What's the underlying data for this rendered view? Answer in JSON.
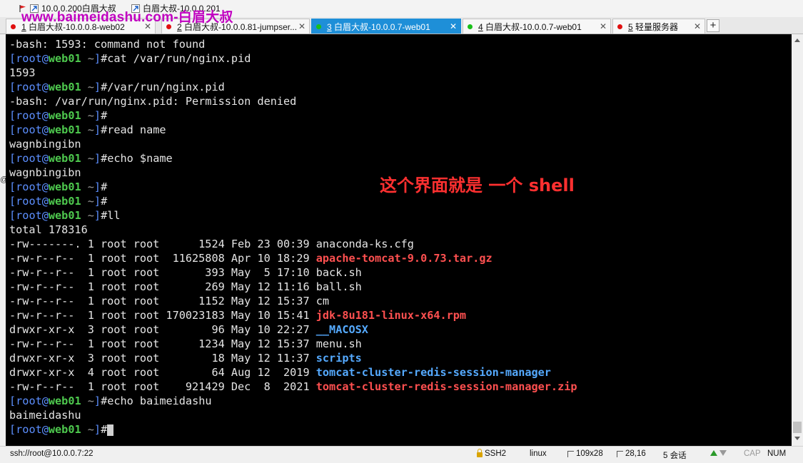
{
  "bookmarks": [
    {
      "label": "10.0.0.200白眉大叔",
      "icon": "red-flag-icon"
    },
    {
      "label": "白眉大叔-10.0.0.201",
      "icon": "shortcut-arrow-icon"
    }
  ],
  "watermark": "www.baimeidashu.com-白眉大叔",
  "tabs": [
    {
      "num": "1",
      "label": " 白眉大叔-10.0.0.8-web02",
      "dot_color": "#e01010",
      "active": false
    },
    {
      "num": "2",
      "label": " 白眉大叔-10.0.0.81-jumpser...",
      "dot_color": "#e01010",
      "active": false
    },
    {
      "num": "3",
      "label": " 白眉大叔-10.0.0.7-web01",
      "dot_color": "#19c019",
      "active": true
    },
    {
      "num": "4",
      "label": " 白眉大叔-10.0.0.7-web01",
      "dot_color": "#19c019",
      "active": false
    },
    {
      "num": "5",
      "label": " 轻量服务器",
      "dot_color": "#e01010",
      "active": false
    }
  ],
  "add_tab_label": "+",
  "annotation": "这个界面就是 一个 shell",
  "left_edge_char": "@",
  "terminal_lines": [
    [
      {
        "t": "-bash: 1593: command not found"
      }
    ],
    [
      {
        "t": "[",
        "c": "b"
      },
      {
        "t": "root",
        "c": "b"
      },
      {
        "t": "@",
        "c": "b"
      },
      {
        "t": "web01",
        "c": "g"
      },
      {
        "t": " ~",
        "c": "gr"
      },
      {
        "t": "]",
        "c": "b"
      },
      {
        "t": "#cat /var/run/nginx.pid"
      }
    ],
    [
      {
        "t": "1593"
      }
    ],
    [
      {
        "t": "[",
        "c": "b"
      },
      {
        "t": "root",
        "c": "b"
      },
      {
        "t": "@",
        "c": "b"
      },
      {
        "t": "web01",
        "c": "g"
      },
      {
        "t": " ~",
        "c": "gr"
      },
      {
        "t": "]",
        "c": "b"
      },
      {
        "t": "#/var/run/nginx.pid"
      }
    ],
    [
      {
        "t": "-bash: /var/run/nginx.pid: Permission denied"
      }
    ],
    [
      {
        "t": "[",
        "c": "b"
      },
      {
        "t": "root",
        "c": "b"
      },
      {
        "t": "@",
        "c": "b"
      },
      {
        "t": "web01",
        "c": "g"
      },
      {
        "t": " ~",
        "c": "gr"
      },
      {
        "t": "]",
        "c": "b"
      },
      {
        "t": "#"
      }
    ],
    [
      {
        "t": "[",
        "c": "b"
      },
      {
        "t": "root",
        "c": "b"
      },
      {
        "t": "@",
        "c": "b"
      },
      {
        "t": "web01",
        "c": "g"
      },
      {
        "t": " ~",
        "c": "gr"
      },
      {
        "t": "]",
        "c": "b"
      },
      {
        "t": "#read name"
      }
    ],
    [
      {
        "t": "wagnbingibn"
      }
    ],
    [
      {
        "t": "[",
        "c": "b"
      },
      {
        "t": "root",
        "c": "b"
      },
      {
        "t": "@",
        "c": "b"
      },
      {
        "t": "web01",
        "c": "g"
      },
      {
        "t": " ~",
        "c": "gr"
      },
      {
        "t": "]",
        "c": "b"
      },
      {
        "t": "#echo $name"
      }
    ],
    [
      {
        "t": "wagnbingibn"
      }
    ],
    [
      {
        "t": "[",
        "c": "b"
      },
      {
        "t": "root",
        "c": "b"
      },
      {
        "t": "@",
        "c": "b"
      },
      {
        "t": "web01",
        "c": "g"
      },
      {
        "t": " ~",
        "c": "gr"
      },
      {
        "t": "]",
        "c": "b"
      },
      {
        "t": "#"
      }
    ],
    [
      {
        "t": "[",
        "c": "b"
      },
      {
        "t": "root",
        "c": "b"
      },
      {
        "t": "@",
        "c": "b"
      },
      {
        "t": "web01",
        "c": "g"
      },
      {
        "t": " ~",
        "c": "gr"
      },
      {
        "t": "]",
        "c": "b"
      },
      {
        "t": "#"
      }
    ],
    [
      {
        "t": "[",
        "c": "b"
      },
      {
        "t": "root",
        "c": "b"
      },
      {
        "t": "@",
        "c": "b"
      },
      {
        "t": "web01",
        "c": "g"
      },
      {
        "t": " ~",
        "c": "gr"
      },
      {
        "t": "]",
        "c": "b"
      },
      {
        "t": "#ll"
      }
    ],
    [
      {
        "t": "total 178316"
      }
    ],
    [
      {
        "t": "-rw-------. 1 root root      1524 Feb 23 00:39 "
      },
      {
        "t": "anaconda-ks.cfg"
      }
    ],
    [
      {
        "t": "-rw-r--r--  1 root root  11625808 Apr 10 18:29 "
      },
      {
        "t": "apache-tomcat-9.0.73.tar.gz",
        "c": "red"
      }
    ],
    [
      {
        "t": "-rw-r--r--  1 root root       393 May  5 17:10 "
      },
      {
        "t": "back.sh"
      }
    ],
    [
      {
        "t": "-rw-r--r--  1 root root       269 May 12 11:16 "
      },
      {
        "t": "ball.sh"
      }
    ],
    [
      {
        "t": "-rw-r--r--  1 root root      1152 May 12 15:37 "
      },
      {
        "t": "cm"
      }
    ],
    [
      {
        "t": "-rw-r--r--  1 root root 170023183 May 10 15:41 "
      },
      {
        "t": "jdk-8u181-linux-x64.rpm",
        "c": "red"
      }
    ],
    [
      {
        "t": "drwxr-xr-x  3 root root        96 May 10 22:27 "
      },
      {
        "t": "__MACOSX",
        "c": "blue"
      }
    ],
    [
      {
        "t": "-rw-r--r--  1 root root      1234 May 12 15:37 "
      },
      {
        "t": "menu.sh"
      }
    ],
    [
      {
        "t": "drwxr-xr-x  3 root root        18 May 12 11:37 "
      },
      {
        "t": "scripts",
        "c": "blue"
      }
    ],
    [
      {
        "t": "drwxr-xr-x  4 root root        64 Aug 12  2019 "
      },
      {
        "t": "tomcat-cluster-redis-session-manager",
        "c": "blue"
      }
    ],
    [
      {
        "t": "-rw-r--r--  1 root root    921429 Dec  8  2021 "
      },
      {
        "t": "tomcat-cluster-redis-session-manager.zip",
        "c": "red"
      }
    ],
    [
      {
        "t": "[",
        "c": "b"
      },
      {
        "t": "root",
        "c": "b"
      },
      {
        "t": "@",
        "c": "b"
      },
      {
        "t": "web01",
        "c": "g"
      },
      {
        "t": " ~",
        "c": "gr"
      },
      {
        "t": "]",
        "c": "b"
      },
      {
        "t": "#echo baimeidashu"
      }
    ],
    [
      {
        "t": "baimeidashu"
      }
    ],
    [
      {
        "t": "[",
        "c": "b"
      },
      {
        "t": "root",
        "c": "b"
      },
      {
        "t": "@",
        "c": "b"
      },
      {
        "t": "web01",
        "c": "g"
      },
      {
        "t": " ~",
        "c": "gr"
      },
      {
        "t": "]",
        "c": "b"
      },
      {
        "t": "#"
      },
      {
        "cursor": true
      }
    ]
  ],
  "status": {
    "connection": "ssh://root@10.0.0.7:22",
    "protocol": "SSH2",
    "terminal_type": "linux",
    "size": "109x28",
    "cursor_pos": "28,16",
    "sessions": "5 会话",
    "caps": "CAP",
    "numlock": "NUM"
  },
  "colors": {
    "prompt_bracket": "#5c8fff",
    "prompt_host": "#4ec94e",
    "archive_file": "#ff5050",
    "directory": "#55aaff",
    "active_tab": "#1e8fd8",
    "annotation": "#ff3030",
    "watermark": "#c000c0"
  }
}
